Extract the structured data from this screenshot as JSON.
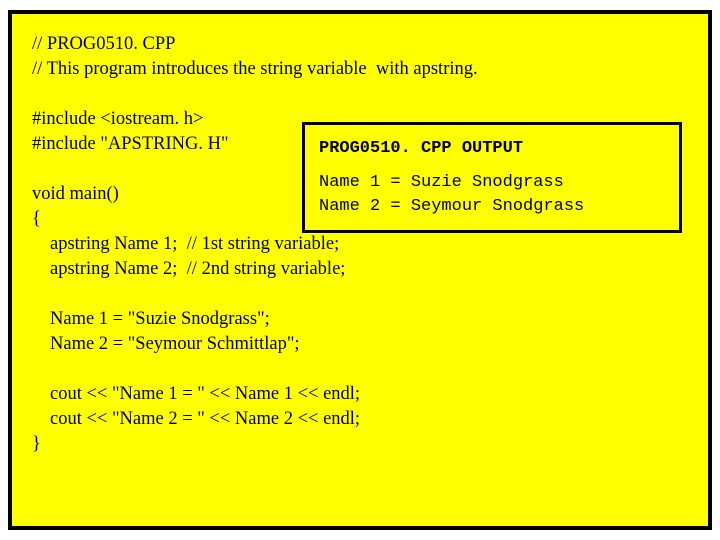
{
  "code": {
    "l1": "// PROG0510. CPP",
    "l2": "// This program introduces the string variable  with apstring.",
    "l3": "#include <iostream. h>",
    "l4": "#include \"APSTRING. H\"",
    "l5": "void main()",
    "l6": "{",
    "l7": "apstring Name 1;  // 1st string variable;",
    "l8": "apstring Name 2;  // 2nd string variable;",
    "l9": "Name 1 = \"Suzie Snodgrass\";",
    "l10": "Name 2 = \"Seymour Schmittlap\";",
    "l11": "cout << \"Name 1 = \" << Name 1 << endl;",
    "l12": "cout << \"Name 2 = \" << Name 2 << endl;",
    "l13": "}"
  },
  "output": {
    "title": "PROG0510. CPP OUTPUT",
    "line1": "Name 1 = Suzie Snodgrass",
    "line2": "Name 2 = Seymour Snodgrass"
  }
}
